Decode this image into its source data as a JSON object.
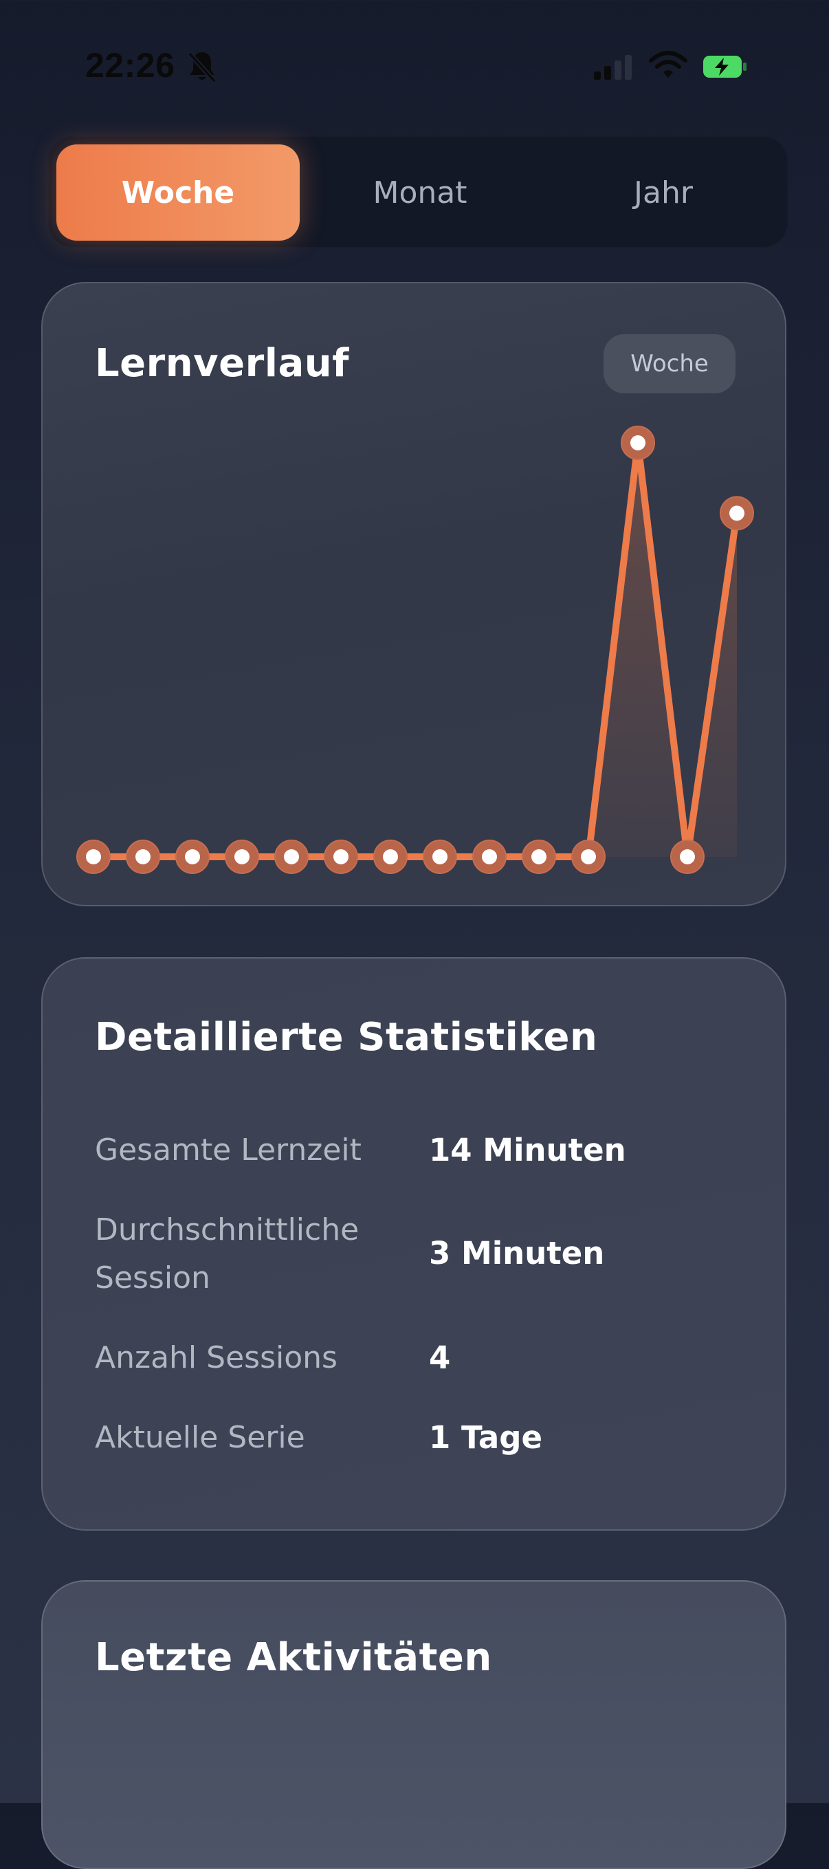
{
  "status_bar": {
    "time": "22:26",
    "icons": [
      "bell-slash-icon",
      "signal-icon",
      "wifi-icon",
      "battery-charging-icon"
    ],
    "battery_color": "#4cd964"
  },
  "period_tabs": {
    "items": [
      {
        "label": "Woche",
        "active": true
      },
      {
        "label": "Monat",
        "active": false
      },
      {
        "label": "Jahr",
        "active": false
      }
    ],
    "accent_color": "#ee7b4a"
  },
  "chart_card": {
    "title": "Lernverlauf",
    "badge": "Woche"
  },
  "chart_data": {
    "type": "line",
    "series": [
      {
        "values": [
          0,
          0,
          0,
          0,
          0,
          0,
          0,
          0,
          0,
          0,
          0,
          10,
          0,
          8.3
        ]
      }
    ],
    "ylim": [
      0,
      10
    ],
    "line_color": "#ee7b4a",
    "point_color": "#ffffff"
  },
  "stats_card": {
    "title": "Detaillierte Statistiken",
    "rows": [
      {
        "label": "Gesamte Lernzeit",
        "value": "14 Minuten"
      },
      {
        "label": "Durchschnittliche Session",
        "value": "3 Minuten"
      },
      {
        "label": "Anzahl Sessions",
        "value": "4"
      },
      {
        "label": "Aktuelle Serie",
        "value": "1 Tage"
      }
    ]
  },
  "activity_card": {
    "title": "Letzte Aktivitäten"
  }
}
